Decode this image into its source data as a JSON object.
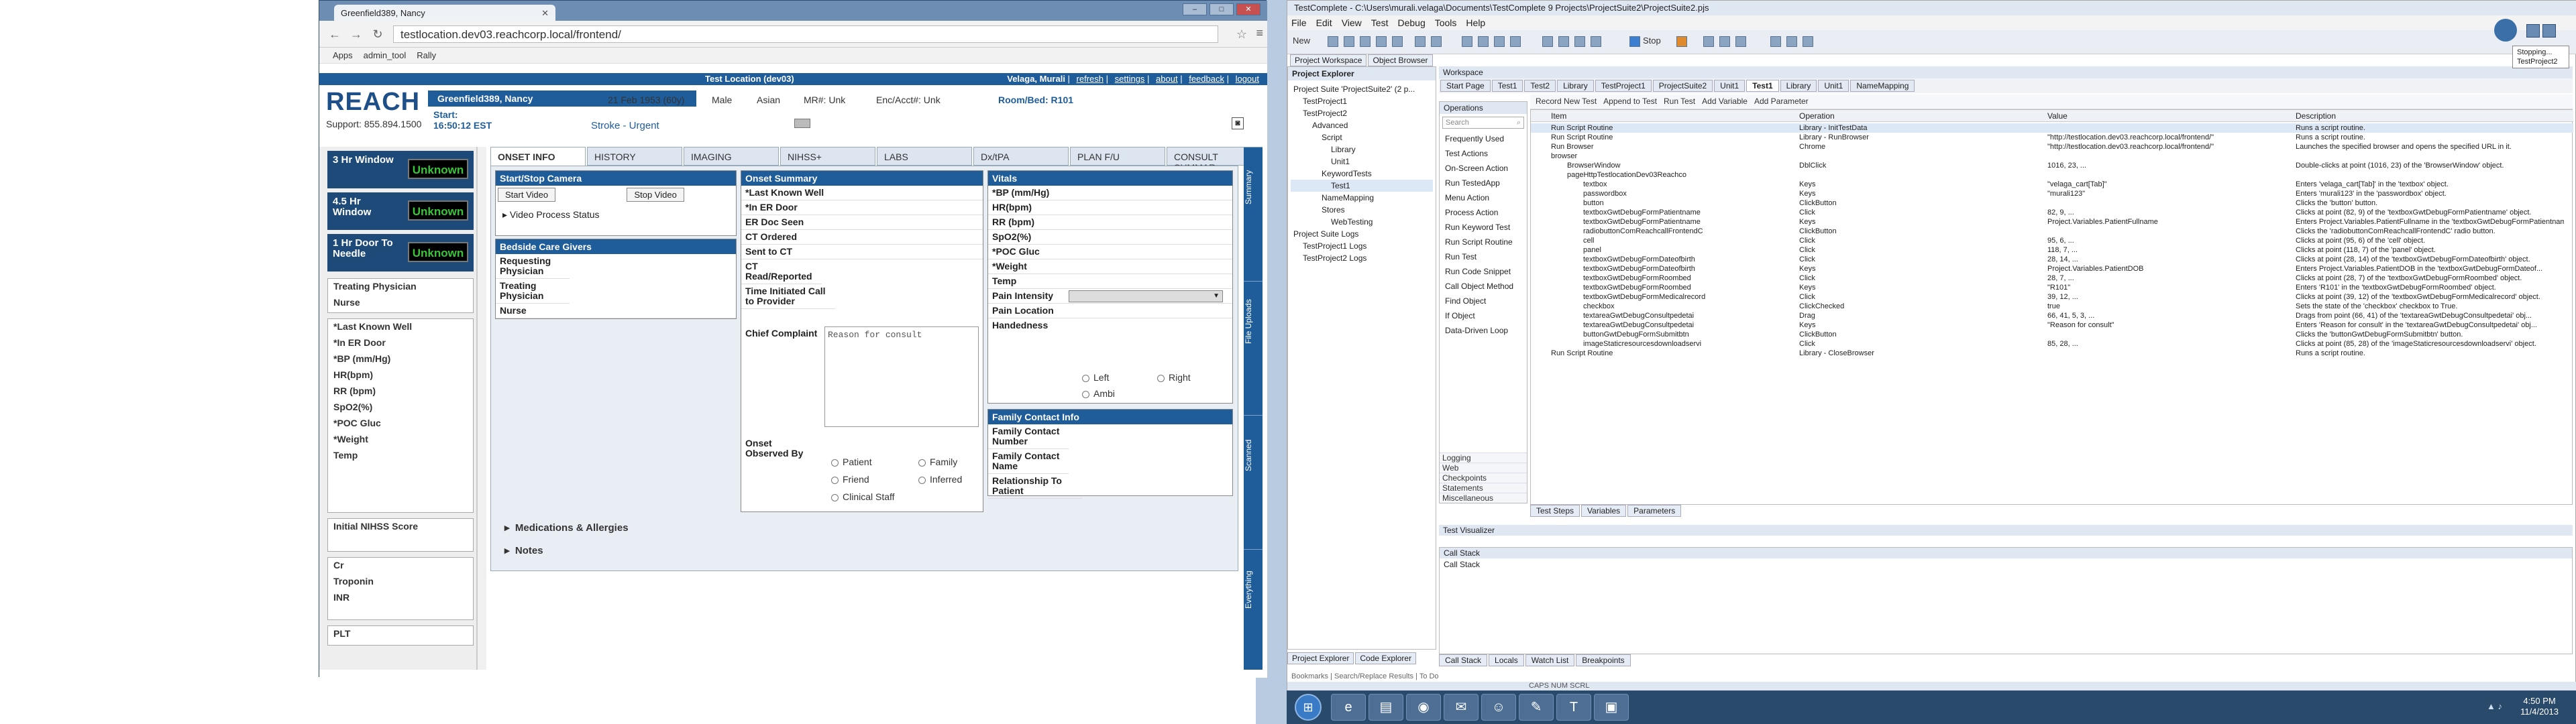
{
  "browser": {
    "tab_title": "Greenfield389, Nancy",
    "url": "testlocation.dev03.reachcorp.local/frontend/",
    "bookmarks": [
      "Apps",
      "admin_tool",
      "Rally"
    ]
  },
  "app": {
    "location": "Test Location (dev03)",
    "user": "Velaga, Murali",
    "links": [
      "refresh",
      "settings",
      "about",
      "feedback",
      "logout"
    ],
    "logo": "REACH",
    "support": "Support: 855.894.1500",
    "patient": {
      "name": "Greenfield389, Nancy",
      "dob": "21 Feb 1953 (60y)",
      "gender": "Male",
      "race": "Asian",
      "mrn": "MR#: Unk",
      "enc": "Enc/Acct#: Unk",
      "room": "Room/Bed: R101",
      "start_label": "Start:",
      "start_time": "16:50:12 EST",
      "diagnosis": "Stroke - Urgent"
    },
    "timers": [
      {
        "label": "3 Hr Window",
        "value": "Unknown"
      },
      {
        "label": "4.5 Hr Window",
        "value": "Unknown"
      },
      {
        "label": "1 Hr Door To Needle",
        "value": "Unknown"
      }
    ],
    "sidebar_groups": [
      [
        "Treating Physician",
        "Nurse"
      ],
      [
        "*Last Known Well",
        "*In ER Door",
        "*BP (mm/Hg)",
        "HR(bpm)",
        "RR (bpm)",
        "SpO2(%)",
        "*POC Gluc",
        "*Weight",
        "Temp"
      ],
      [
        "Initial NIHSS Score"
      ],
      [
        "Cr",
        "Troponin",
        "INR"
      ],
      [
        "PLT"
      ]
    ],
    "tabs": [
      "ONSET INFO",
      "HISTORY",
      "IMAGING",
      "NIHSS+",
      "LABS",
      "Dx/tPA",
      "PLAN F/U",
      "CONSULT SUMMAR"
    ],
    "video": {
      "title": "Start/Stop Camera",
      "start_btn": "Start Video",
      "stop_btn": "Stop Video",
      "process_status": "Video Process Status"
    },
    "caregivers": {
      "title": "Bedside Care Givers",
      "rows": [
        "Requesting Physician",
        "Treating Physician",
        "Nurse"
      ]
    },
    "onset": {
      "title": "Onset Summary",
      "rows": [
        "*Last Known Well",
        "*In ER Door",
        "ER Doc Seen",
        "CT Ordered",
        "Sent to CT",
        "CT Read/Reported",
        "Time Initiated Call to Provider"
      ],
      "complaint_label": "Chief Complaint",
      "complaint_placeholder": "Reason for consult",
      "observed_label": "Onset Observed By",
      "observers": [
        "Patient",
        "Family",
        "Friend",
        "Inferred",
        "Clinical Staff"
      ]
    },
    "vitals": {
      "title": "Vitals",
      "rows": [
        "*BP (mm/Hg)",
        "HR(bpm)",
        "RR (bpm)",
        "SpO2(%)",
        "*POC Gluc",
        "*Weight",
        "Temp"
      ],
      "pain": "Pain Intensity",
      "pain_location": "Pain Location",
      "handedness": "Handedness",
      "hands": [
        "Left",
        "Right",
        "Ambi"
      ]
    },
    "family": {
      "title": "Family Contact Info",
      "rows": [
        "Family Contact Number",
        "Family Contact Name",
        "Relationship To Patient"
      ]
    },
    "expanders": [
      "Medications & Allergies",
      "Notes"
    ],
    "right_tabs": [
      "Summary",
      "File Uploads",
      "Scanned",
      "Everything"
    ]
  },
  "testcomplete": {
    "title": "TestComplete - C:\\Users\\murali.velaga\\Documents\\TestComplete 9 Projects\\ProjectSuite2\\ProjectSuite2.pjs",
    "menu": [
      "File",
      "Edit",
      "View",
      "Test",
      "Debug",
      "Tools",
      "Help"
    ],
    "toolbar_new": "New",
    "toolbar_stop": "Stop",
    "panel_tabs": [
      "Project Workspace",
      "Object Browser"
    ],
    "explorer_title": "Project Explorer",
    "tree": [
      "Project Suite 'ProjectSuite2' (2 p...",
      "TestProject1",
      "TestProject2",
      "Advanced",
      "Script",
      "Library",
      "Unit1",
      "KeywordTests",
      "Test1",
      "NameMapping",
      "Stores",
      "WebTesting",
      "Project Suite Logs",
      "TestProject1 Logs",
      "TestProject2 Logs"
    ],
    "workspace_title": "Workspace",
    "doc_tabs": [
      "Start Page",
      "Test1",
      "Test2",
      "Library",
      "TestProject1",
      "ProjectSuite2",
      "Unit1",
      "Test1",
      "Library",
      "Unit1",
      "NameMapping"
    ],
    "active_doc_tab": "Test1",
    "operations_title": "Operations",
    "search_placeholder": "Search",
    "ops_items": [
      "Frequently Used",
      "Test Actions",
      "On-Screen Action",
      "Run TestedApp",
      "Menu Action",
      "Process Action",
      "Run Keyword Test",
      "Run Script Routine",
      "Run Test",
      "Run Code Snippet",
      "Call Object Method",
      "Find Object",
      "If Object",
      "Data-Driven Loop"
    ],
    "ops_categories": [
      "Logging",
      "Web",
      "Checkpoints",
      "Statements",
      "Miscellaneous"
    ],
    "kw_toolbar": [
      "Record New Test",
      "Append to Test",
      "Run Test",
      "Add Variable",
      "Add Parameter"
    ],
    "columns": [
      "Item",
      "Operation",
      "Value",
      "Description"
    ],
    "rows": [
      [
        "Run Script Routine",
        "Library - InitTestData",
        "",
        "Runs a script routine."
      ],
      [
        "Run Script Routine",
        "Library - RunBrowser",
        "\"http://testlocation.dev03.reachcorp.local/frontend/\"",
        "Runs a script routine."
      ],
      [
        "Run Browser",
        "Chrome",
        "\"http://testlocation.dev03.reachcorp.local/frontend/\"",
        "Launches the specified browser and opens the specified URL in it."
      ],
      [
        "browser",
        "",
        "",
        ""
      ],
      [
        "BrowserWindow",
        "DblClick",
        "1016, 23, ...",
        "Double-clicks at point (1016, 23) of the 'BrowserWindow' object."
      ],
      [
        "pageHttpTestlocationDev03Reachco",
        "",
        "",
        ""
      ],
      [
        "textbox",
        "Keys",
        "\"velaga_cart[Tab]\"",
        "Enters 'velaga_cart[Tab]' in the 'textbox' object."
      ],
      [
        "passwordbox",
        "Keys",
        "\"murali123\"",
        "Enters 'murali123' in the 'passwordbox' object."
      ],
      [
        "button",
        "ClickButton",
        "",
        "Clicks the 'button' button."
      ],
      [
        "textboxGwtDebugFormPatientname",
        "Click",
        "82, 9, ...",
        "Clicks at point (82, 9) of the 'textboxGwtDebugFormPatientname' object."
      ],
      [
        "textboxGwtDebugFormPatientname",
        "Keys",
        "Project.Variables.PatientFullname",
        "Enters Project.Variables.PatientFullname in the 'textboxGwtDebugFormPatientname' object."
      ],
      [
        "radiobuttonComReachcallFrontendC",
        "ClickButton",
        "",
        "Clicks the 'radiobuttonComReachcallFrontendC' radio button."
      ],
      [
        "cell",
        "Click",
        "95, 6, ...",
        "Clicks at point (95, 6) of the 'cell' object."
      ],
      [
        "panel",
        "Click",
        "118, 7, ...",
        "Clicks at point (118, 7) of the 'panel' object."
      ],
      [
        "textboxGwtDebugFormDateofbirth",
        "Click",
        "28, 14, ...",
        "Clicks at point (28, 14) of the 'textboxGwtDebugFormDateofbirth' object."
      ],
      [
        "textboxGwtDebugFormDateofbirth",
        "Keys",
        "Project.Variables.PatientDOB",
        "Enters Project.Variables.PatientDOB in the 'textboxGwtDebugFormDateof..."
      ],
      [
        "textboxGwtDebugFormRoombed",
        "Click",
        "28, 7, ...",
        "Clicks at point (28, 7) of the 'textboxGwtDebugFormRoombed' object."
      ],
      [
        "textboxGwtDebugFormRoombed",
        "Keys",
        "\"R101\"",
        "Enters 'R101' in the 'textboxGwtDebugFormRoombed' object."
      ],
      [
        "textboxGwtDebugFormMedicalrecord",
        "Click",
        "39, 12, ...",
        "Clicks at point (39, 12) of the 'textboxGwtDebugFormMedicalrecord' object."
      ],
      [
        "checkbox",
        "ClickChecked",
        "true",
        "Sets the state of the 'checkbox' checkbox to True."
      ],
      [
        "textareaGwtDebugConsultpedetai",
        "Drag",
        "66, 41, 5, 3, ...",
        "Drags from point (66, 41) of the 'textareaGwtDebugConsultpedetai' obj..."
      ],
      [
        "textareaGwtDebugConsultpedetai",
        "Keys",
        "\"Reason for consult\"",
        "Enters 'Reason for consult' in the 'textareaGwtDebugConsultpedetai' obj..."
      ],
      [
        "buttonGwtDebugFormSubmitbtn",
        "ClickButton",
        "",
        "Clicks the 'buttonGwtDebugFormSubmitbtn' button."
      ],
      [
        "imageStaticresourcesdownloadservi",
        "Click",
        "85, 28, ...",
        "Clicks at point (85, 28) of the 'imageStaticresourcesdownloadservi' object."
      ],
      [
        "Run Script Routine",
        "Library - CloseBrowser",
        "",
        "Runs a script routine."
      ]
    ],
    "bottom_tabs": [
      "Test Steps",
      "Variables",
      "Parameters"
    ],
    "visualizer": "Test Visualizer",
    "callstack_title": "Call Stack",
    "callstack_col": "Call Stack",
    "cs_tabs": [
      "Call Stack",
      "Locals",
      "Watch List",
      "Breakpoints"
    ],
    "pe_tabs": [
      "Project Explorer",
      "Code Explorer"
    ],
    "bottom_bar": [
      "Bookmarks",
      "Search/Replace Results",
      "To Do"
    ],
    "status": "CAPS  NUM  SCRL",
    "popup_lines": [
      "Stopping...",
      "TestProject2"
    ]
  },
  "taskbar": {
    "time": "4:50 PM",
    "date": "11/4/2013"
  }
}
